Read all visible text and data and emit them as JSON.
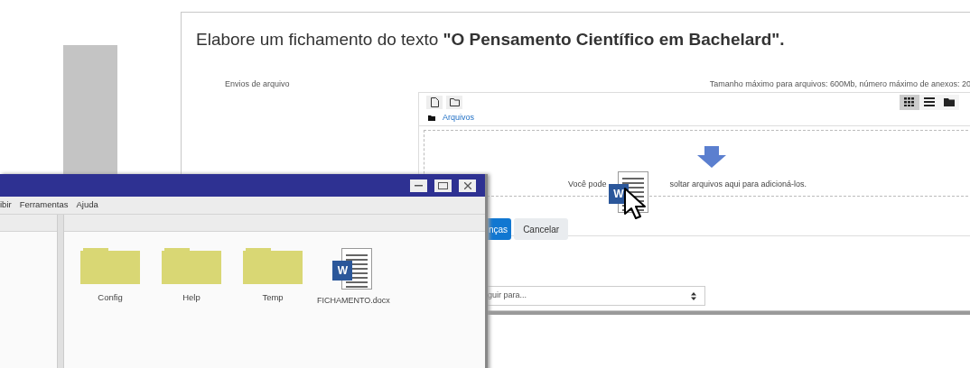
{
  "assignment": {
    "title": "Elabore um fichamento do texto **\"O Pensamento Científico em Bachelard\".**",
    "upload_label": "Envios de arquivo",
    "limits": "Tamanho máximo para arquivos: 600Mb, número máximo de anexos: 20",
    "view_buttons": [
      {
        "kind": "grid",
        "selected": true
      },
      {
        "kind": "list",
        "selected": false
      },
      {
        "kind": "tree",
        "selected": false
      }
    ],
    "breadcrumb": "Arquivos",
    "dropzone": {
      "text_before": "Você pode",
      "text_after": "soltar arquivos aqui para adicioná-los."
    },
    "buttons": [
      {
        "label": "nças",
        "kind": "primary"
      },
      {
        "label": "Cancelar",
        "kind": "secondary"
      }
    ],
    "select": {
      "value": "guir para..."
    }
  },
  "dragged_file": {
    "badge": "W"
  },
  "explorer": {
    "menu": [
      "ibir",
      "Ferramentas",
      "Ajuda"
    ],
    "items": [
      {
        "label": "Config",
        "kind": "folder"
      },
      {
        "label": "Help",
        "kind": "folder"
      },
      {
        "label": "Temp",
        "kind": "folder"
      },
      {
        "label": "FICHAMENTO.docx",
        "kind": "document",
        "badge": "W"
      }
    ]
  }
}
